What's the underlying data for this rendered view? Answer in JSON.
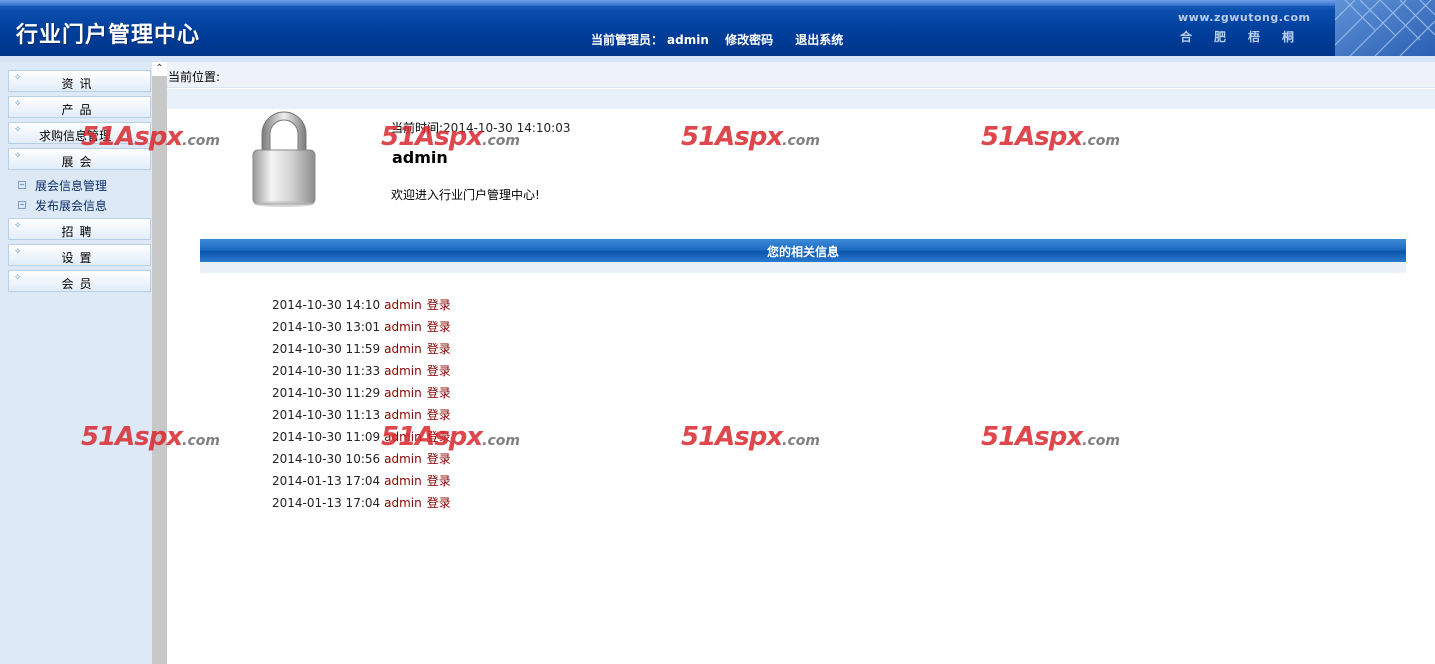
{
  "header": {
    "title": "行业门户管理中心",
    "admin_label": "当前管理员：",
    "admin_name": "admin",
    "change_password": "修改密码",
    "logout": "退出系统",
    "site_url": "www.zgwutong.com",
    "city": "合肥梧桐"
  },
  "sidebar": {
    "items": [
      {
        "label": "资讯",
        "icon": "plus-icon"
      },
      {
        "label": "产品",
        "icon": "plus-icon"
      },
      {
        "label": "求购信息管理",
        "icon": "plus-icon"
      },
      {
        "label": "展会",
        "icon": "plus-icon",
        "expanded": true
      },
      {
        "label": "招聘",
        "icon": "plus-icon"
      },
      {
        "label": "设置",
        "icon": "plus-icon"
      },
      {
        "label": "会员",
        "icon": "plus-icon"
      }
    ],
    "sub_items": [
      {
        "label": "展会信息管理",
        "icon": "minus-box-icon"
      },
      {
        "label": "发布展会信息",
        "icon": "minus-box-icon"
      }
    ]
  },
  "breadcrumb": {
    "label": "当前位置:"
  },
  "welcome": {
    "time_label": "当前时间:",
    "time_value": "2014-10-30 14:10:03",
    "user": "admin",
    "message": "欢迎进入行业门户管理中心!"
  },
  "info_bar": {
    "title": "您的相关信息"
  },
  "login_log": [
    {
      "time": "2014-10-30 14:10",
      "user": "admin",
      "action": "登录"
    },
    {
      "time": "2014-10-30 13:01",
      "user": "admin",
      "action": "登录"
    },
    {
      "time": "2014-10-30 11:59",
      "user": "admin",
      "action": "登录"
    },
    {
      "time": "2014-10-30 11:33",
      "user": "admin",
      "action": "登录"
    },
    {
      "time": "2014-10-30 11:29",
      "user": "admin",
      "action": "登录"
    },
    {
      "time": "2014-10-30 11:13",
      "user": "admin",
      "action": "登录"
    },
    {
      "time": "2014-10-30 11:09",
      "user": "admin",
      "action": "登录"
    },
    {
      "time": "2014-10-30 10:56",
      "user": "admin",
      "action": "登录"
    },
    {
      "time": "2014-01-13 17:04",
      "user": "admin",
      "action": "登录"
    },
    {
      "time": "2014-01-13 17:04",
      "user": "admin",
      "action": "登录"
    }
  ],
  "watermark": {
    "big": "51Aspx",
    "small": ".com"
  },
  "colors": {
    "header_blue": "#003f9c",
    "sidebar_bg": "#dde9f7",
    "log_red": "#8b0000",
    "info_bar_blue": "#1d6cc4",
    "watermark_red": "#d9292f"
  }
}
